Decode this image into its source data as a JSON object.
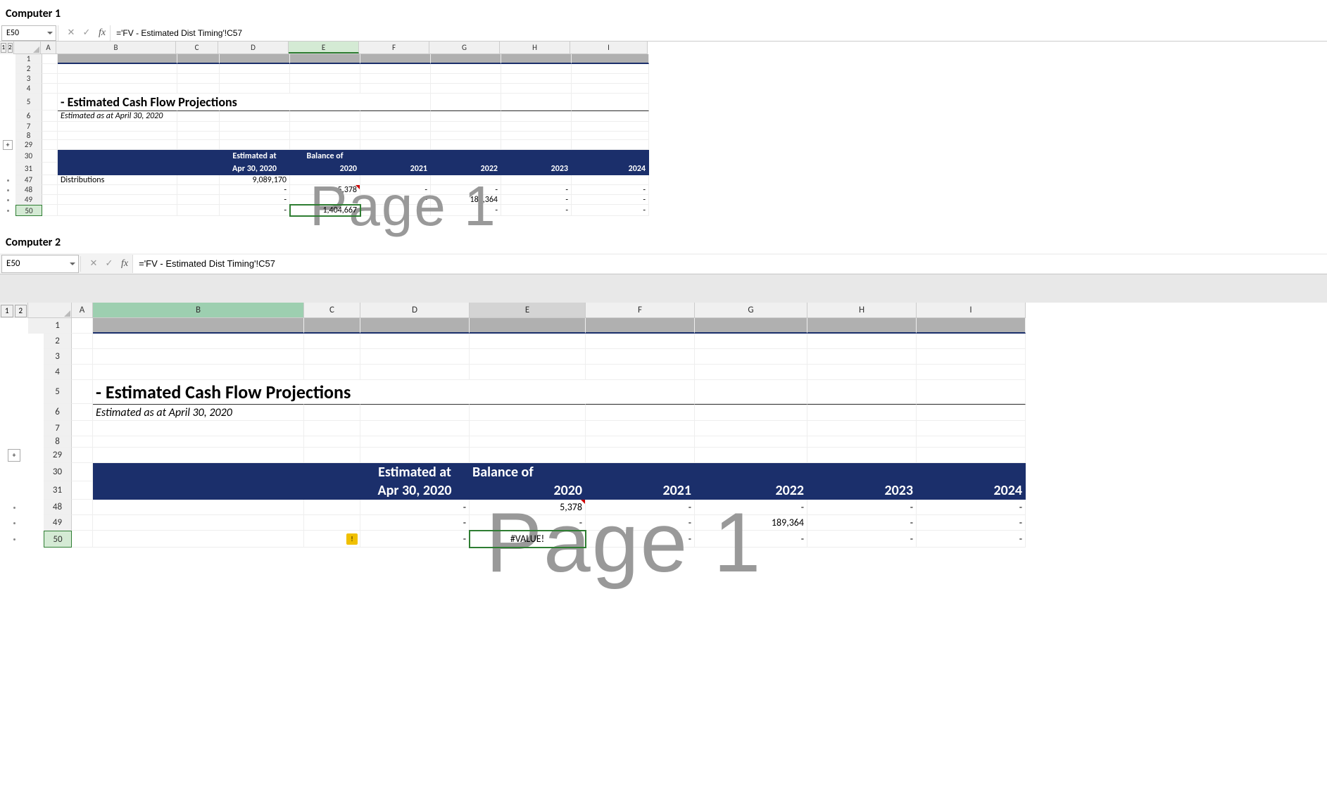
{
  "labels": {
    "computer1": "Computer 1",
    "computer2": "Computer 2"
  },
  "outline_levels": [
    "1",
    "2"
  ],
  "formula_bar": {
    "cell_ref": "E50",
    "formula": "='FV - Estimated Dist Timing'!C57",
    "fx": "fx"
  },
  "columns": [
    "A",
    "B",
    "C",
    "D",
    "E",
    "F",
    "G",
    "H",
    "I"
  ],
  "c1": {
    "rows_visible": [
      "1",
      "2",
      "3",
      "4",
      "5",
      "6",
      "7",
      "8",
      "29",
      "30",
      "31",
      "47",
      "48",
      "49",
      "50"
    ],
    "row5_title": "- Estimated Cash Flow Projections",
    "row6_sub": "Estimated as at April 30, 2020",
    "hdr1": {
      "D": "Estimated at",
      "E": "Balance of"
    },
    "hdr2": {
      "D": "Apr 30, 2020",
      "E": "2020",
      "F": "2021",
      "G": "2022",
      "H": "2023",
      "I": "2024"
    },
    "row47": {
      "B": "Distributions",
      "D": "9,089,170"
    },
    "row48": {
      "D": "-",
      "E": "5,378",
      "F": "-",
      "G": "-",
      "H": "-",
      "I": "-"
    },
    "row49": {
      "D": "-",
      "E": "-",
      "F": "-",
      "G": "189,364",
      "H": "-",
      "I": "-"
    },
    "row50": {
      "D": "-",
      "E": "1,404,667",
      "F": "-",
      "G": "-",
      "H": "-",
      "I": "-"
    },
    "watermark": "Page 1"
  },
  "c2": {
    "rows_visible": [
      "1",
      "2",
      "3",
      "4",
      "5",
      "6",
      "7",
      "8",
      "29",
      "30",
      "31",
      "48",
      "49",
      "50"
    ],
    "row5_title": "- Estimated Cash Flow Projections",
    "row6_sub": "Estimated as at April 30, 2020",
    "hdr1": {
      "D": "Estimated at",
      "E": "Balance of"
    },
    "hdr2": {
      "D": "Apr 30, 2020",
      "E": "2020",
      "F": "2021",
      "G": "2022",
      "H": "2023",
      "I": "2024"
    },
    "row48": {
      "D": "-",
      "E": "5,378",
      "F": "-",
      "G": "-",
      "H": "-",
      "I": "-"
    },
    "row49": {
      "D": "-",
      "E": "-",
      "F": "-",
      "G": "189,364",
      "H": "-",
      "I": "-"
    },
    "row50": {
      "D": "-",
      "E": "#VALUE!",
      "F": "-",
      "G": "-",
      "H": "-",
      "I": "-"
    },
    "watermark": "Page 1"
  }
}
